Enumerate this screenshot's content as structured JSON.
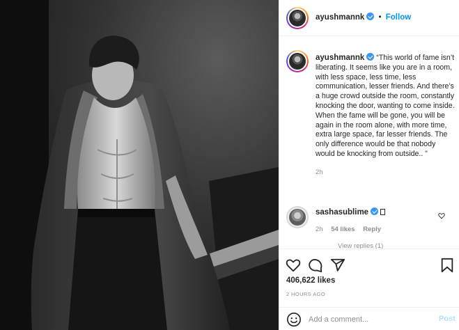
{
  "post": {
    "author": "ayushmannk",
    "verified": true,
    "follow_label": "Follow",
    "separator": "•",
    "caption": "“This world of fame isn’t liberating. It seems like you are in a room, with less space, less time, less communication, lesser friends. And there’s a huge crowd outside the room, constantly knocking the door, wanting to come inside. When the fame will be gone, you will be again in the room alone, with more time, extra large space, far lesser friends. The only difference would be that nobody would be knocking from outside.. ”",
    "caption_time": "2h",
    "likes_text": "406,622 likes",
    "posted_ago": "2 HOURS AGO"
  },
  "comment": {
    "author": "sashasublime",
    "verified": true,
    "time": "2h",
    "likes": "54 likes",
    "reply_label": "Reply",
    "view_replies": "View replies (1)"
  },
  "comment_box": {
    "placeholder": "Add a comment...",
    "post_label": "Post"
  },
  "icons": {
    "like": "heart-icon",
    "comment": "comment-icon",
    "share": "share-icon",
    "save": "bookmark-icon",
    "emoji": "smiley-icon",
    "comment_like": "small-heart-icon"
  },
  "colors": {
    "accent": "#0095f6",
    "verified": "#3897f0",
    "muted": "#8e8e8e",
    "post_disabled": "#b2dffc"
  }
}
